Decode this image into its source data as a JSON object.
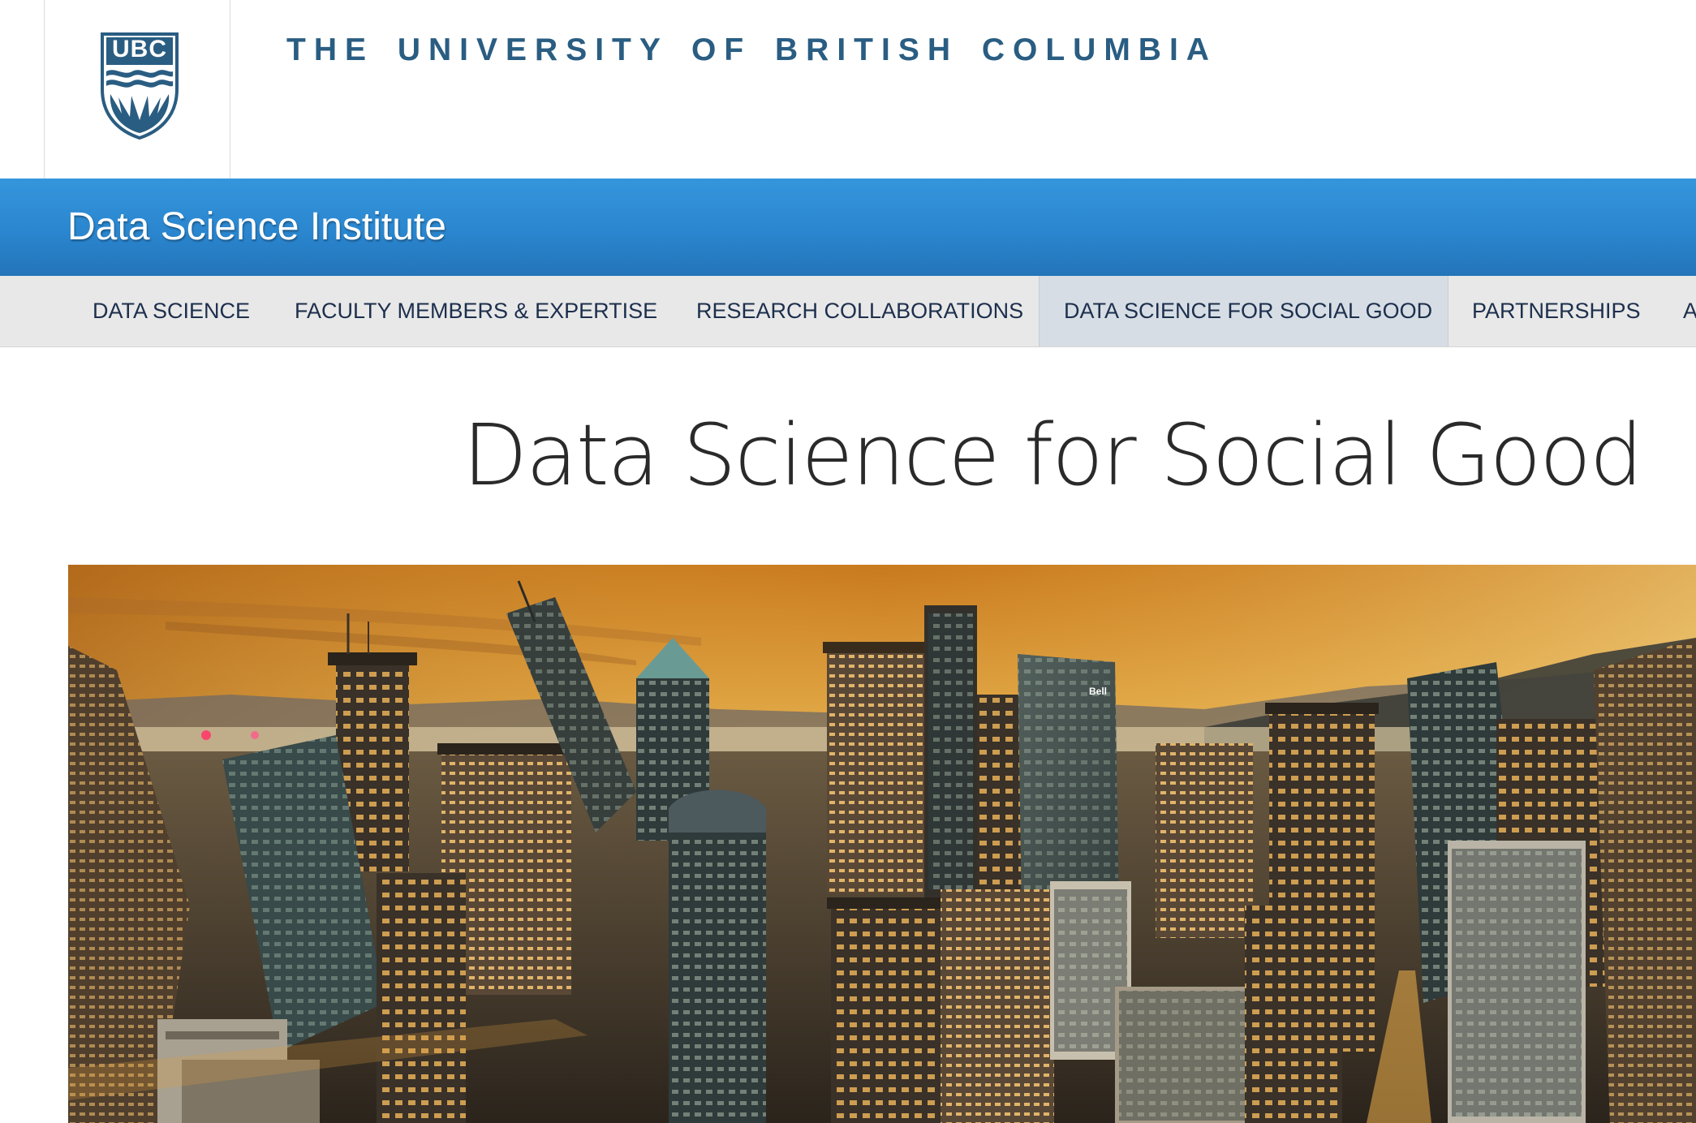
{
  "ubc": {
    "crest_text": "UBC",
    "wordmark": "THE UNIVERSITY OF BRITISH COLUMBIA"
  },
  "unit": {
    "title": "Data Science Institute"
  },
  "nav": {
    "items": [
      {
        "label": "DATA SCIENCE"
      },
      {
        "label": "FACULTY MEMBERS & EXPERTISE"
      },
      {
        "label": "RESEARCH COLLABORATIONS"
      },
      {
        "label": "DATA SCIENCE FOR SOCIAL GOOD",
        "active": true
      },
      {
        "label": "PARTNERSHIPS"
      },
      {
        "label": "A"
      }
    ]
  },
  "page": {
    "title": "Data Science for Social Good"
  },
  "hero": {
    "signs": [
      "Bell"
    ]
  },
  "colors": {
    "ubc_blue": "#2a5d82",
    "unit_bar": "#2a86cf",
    "nav_bg": "#e8e8e8",
    "nav_active": "#d6dde4",
    "nav_text": "#1d2f4d"
  },
  "icons": {
    "crest": "ubc-crest-icon"
  }
}
